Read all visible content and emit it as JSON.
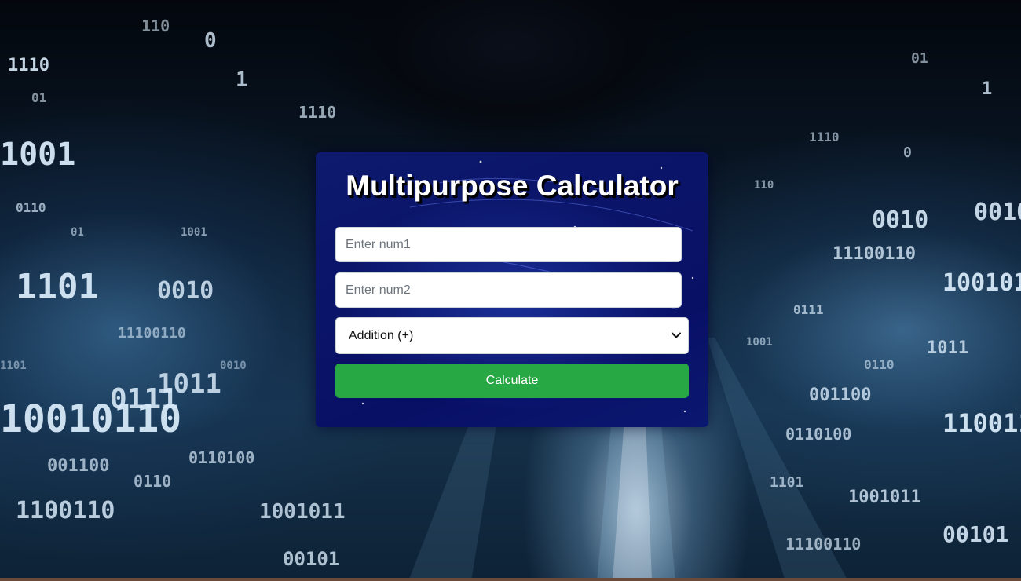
{
  "background": {
    "description_icon": "binary-code-background",
    "digits": [
      "1110",
      "01",
      "1001",
      "0110",
      "1101",
      "0010",
      "11100110",
      "10010110",
      "0111",
      "1011",
      "001100",
      "1100110",
      "0110100",
      "1001011",
      "00101",
      "110",
      "0",
      "1"
    ]
  },
  "calculator": {
    "title": "Multipurpose Calculator",
    "num1_placeholder": "Enter num1",
    "num2_placeholder": "Enter num2",
    "operation_selected": "Addition (+)",
    "calculate_label": "Calculate",
    "button_color": "#28a745",
    "card_color": "#0a1468"
  }
}
